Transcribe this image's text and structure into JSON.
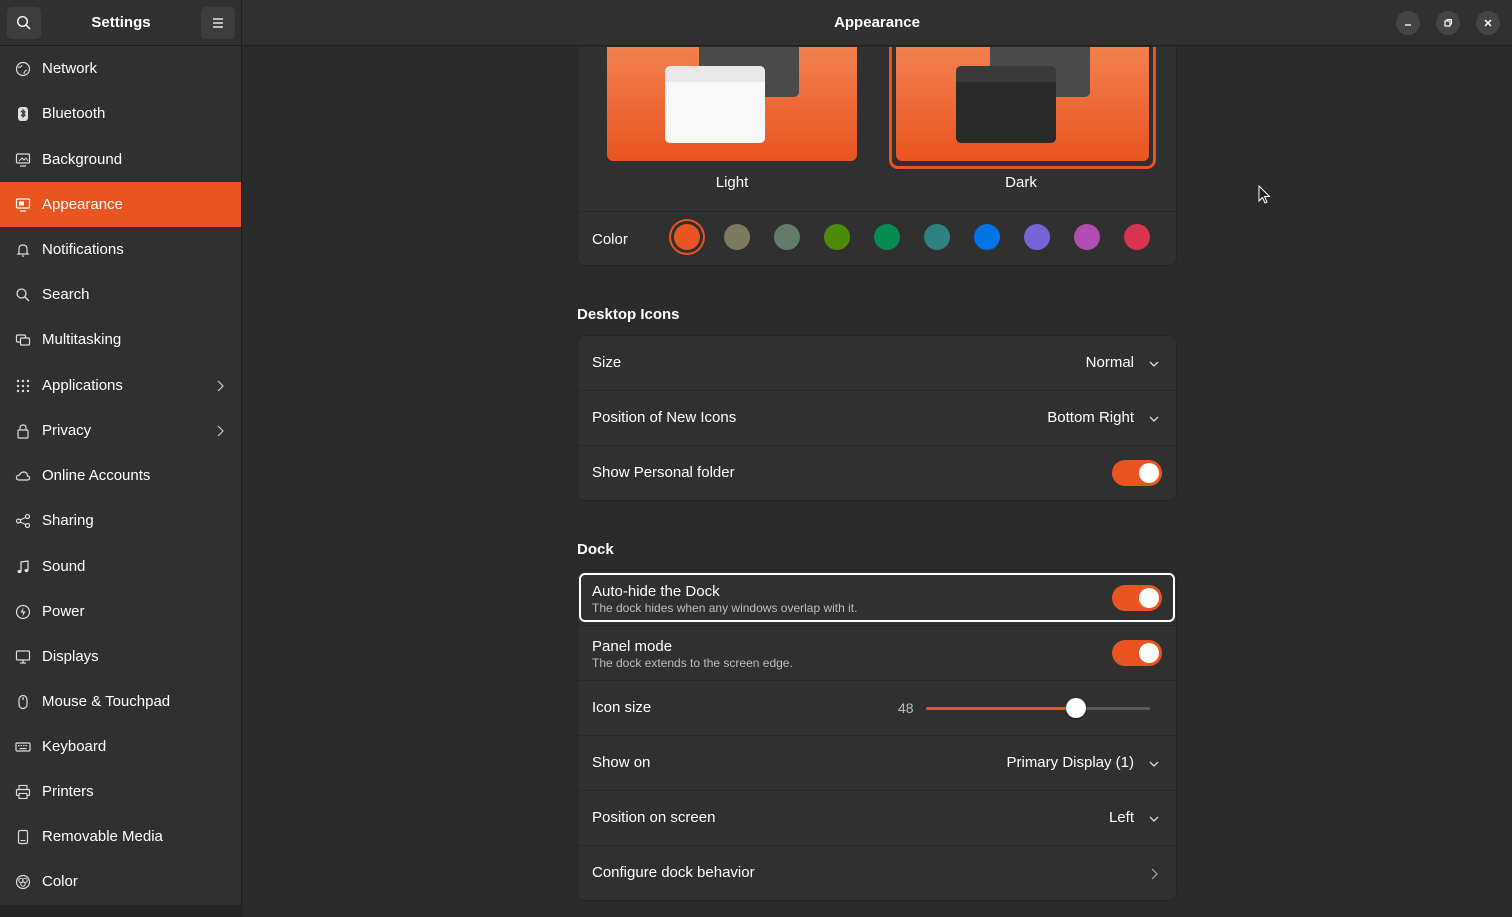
{
  "header": {
    "sidebar_title": "Settings",
    "main_title": "Appearance"
  },
  "sidebar": {
    "items": [
      {
        "label": "Network",
        "icon": "network-icon"
      },
      {
        "label": "Bluetooth",
        "icon": "bluetooth-icon"
      },
      {
        "label": "Background",
        "icon": "background-icon"
      },
      {
        "label": "Appearance",
        "icon": "appearance-icon",
        "active": true
      },
      {
        "label": "Notifications",
        "icon": "bell-icon"
      },
      {
        "label": "Search",
        "icon": "search-icon"
      },
      {
        "label": "Multitasking",
        "icon": "multitasking-icon"
      },
      {
        "label": "Applications",
        "icon": "applications-icon",
        "has_submenu": true
      },
      {
        "label": "Privacy",
        "icon": "lock-icon",
        "has_submenu": true
      },
      {
        "label": "Online Accounts",
        "icon": "cloud-icon"
      },
      {
        "label": "Sharing",
        "icon": "share-icon"
      },
      {
        "label": "Sound",
        "icon": "music-note-icon"
      },
      {
        "label": "Power",
        "icon": "power-icon"
      },
      {
        "label": "Displays",
        "icon": "display-icon"
      },
      {
        "label": "Mouse & Touchpad",
        "icon": "mouse-icon"
      },
      {
        "label": "Keyboard",
        "icon": "keyboard-icon"
      },
      {
        "label": "Printers",
        "icon": "printer-icon"
      },
      {
        "label": "Removable Media",
        "icon": "removable-media-icon"
      },
      {
        "label": "Color",
        "icon": "color-icon"
      }
    ]
  },
  "style": {
    "light_label": "Light",
    "dark_label": "Dark",
    "selected": "Dark",
    "color_label": "Color",
    "accent_colors": [
      "#e95420",
      "#7e7a5f",
      "#657b69",
      "#4e8a0a",
      "#068b50",
      "#308280",
      "#0073e5",
      "#7764d8",
      "#b34cb3",
      "#da3450"
    ],
    "selected_accent": "#e95420"
  },
  "desktop_icons": {
    "title": "Desktop Icons",
    "size_label": "Size",
    "size_value": "Normal",
    "position_label": "Position of New Icons",
    "position_value": "Bottom Right",
    "personal_folder_label": "Show Personal folder",
    "personal_folder_on": true
  },
  "dock": {
    "title": "Dock",
    "autohide_label": "Auto-hide the Dock",
    "autohide_sub": "The dock hides when any windows overlap with it.",
    "autohide_on": true,
    "panel_label": "Panel mode",
    "panel_sub": "The dock extends to the screen edge.",
    "panel_on": true,
    "icon_size_label": "Icon size",
    "icon_size_value": "48",
    "icon_size_fraction": 0.67,
    "show_on_label": "Show on",
    "show_on_value": "Primary Display (1)",
    "position_label": "Position on screen",
    "position_value": "Left",
    "configure_label": "Configure dock behavior"
  },
  "colors": {
    "accent": "#e95420",
    "window_bg": "#2b2b2b",
    "card_bg": "#303030"
  }
}
